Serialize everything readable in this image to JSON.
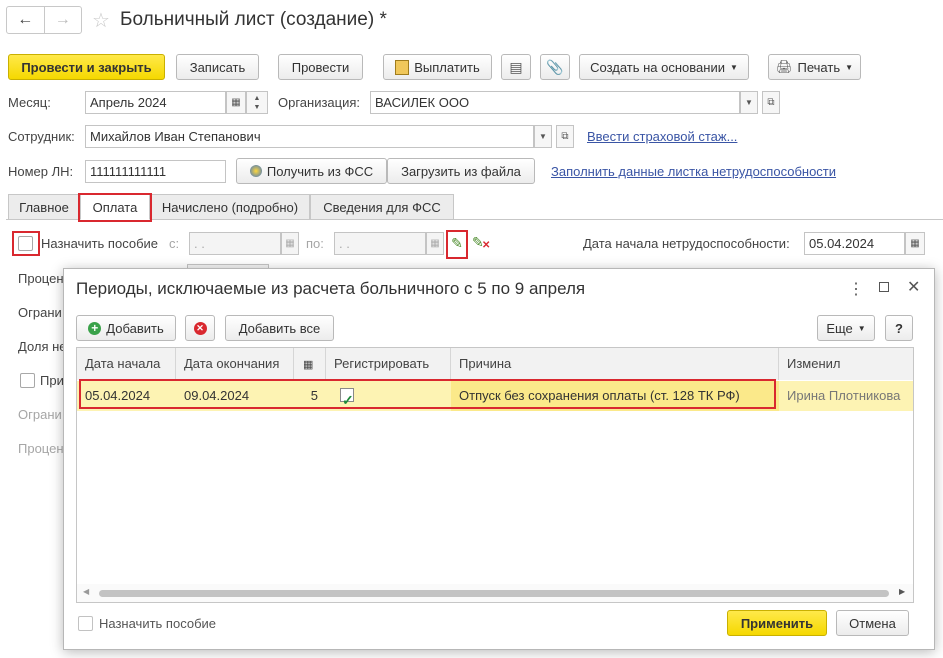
{
  "window": {
    "title": "Больничный лист (создание) *",
    "back_icon": "arrow-left-icon",
    "forward_icon": "arrow-right-icon",
    "favorite_icon": "star-icon"
  },
  "toolbar": {
    "post_close": "Провести и закрыть",
    "save": "Записать",
    "post": "Провести",
    "pay": "Выплатить",
    "create_based": "Создать на основании",
    "print": "Печать"
  },
  "form": {
    "month_label": "Месяц:",
    "month_value": "Апрель 2024",
    "org_label": "Организация:",
    "org_value": "ВАСИЛЕК ООО",
    "employee_label": "Сотрудник:",
    "employee_value": "Михайлов Иван Степанович",
    "insurance_link": "Ввести страховой стаж...",
    "ln_label": "Номер ЛН:",
    "ln_value": "111111111111",
    "get_fss": "Получить из ФСС",
    "load_file": "Загрузить из файла",
    "fill_link": "Заполнить данные листка нетрудоспособности"
  },
  "tabs": [
    "Главное",
    "Оплата",
    "Начислено (подробно)",
    "Сведения для ФСС"
  ],
  "payment": {
    "assign_label": "Назначить пособие",
    "from_label": "с:",
    "from_value": " .  .",
    "to_label": "по:",
    "to_value": " .  .",
    "start_date_label": "Дата начала нетрудоспособности:",
    "start_date_value": "05.04.2024",
    "hidden_labels": [
      "Процен",
      "Ограни",
      "Доля не",
      "При",
      "Ограни",
      "Процен"
    ]
  },
  "dialog": {
    "title": "Периоды, исключаемые из расчета больничного с 5 по 9 апреля",
    "add": "Добавить",
    "add_all": "Добавить все",
    "more": "Еще",
    "help": "?",
    "columns": [
      "Дата начала",
      "Дата окончания",
      "",
      "Регистрировать",
      "Причина",
      "Изменил"
    ],
    "rows": [
      {
        "start": "05.04.2024",
        "end": "09.04.2024",
        "days": "5",
        "register": true,
        "reason": "Отпуск без сохранения оплаты (ст. 128 ТК РФ)",
        "changed_by": "Ирина Плотникова"
      }
    ],
    "footer_checkbox": "Назначить пособие",
    "apply": "Применить",
    "cancel": "Отмена"
  },
  "colors": {
    "accent_yellow": "#f5d800",
    "highlight_red": "#d9282f",
    "row_selected": "#fdf3b3",
    "link": "#3a55a5"
  }
}
